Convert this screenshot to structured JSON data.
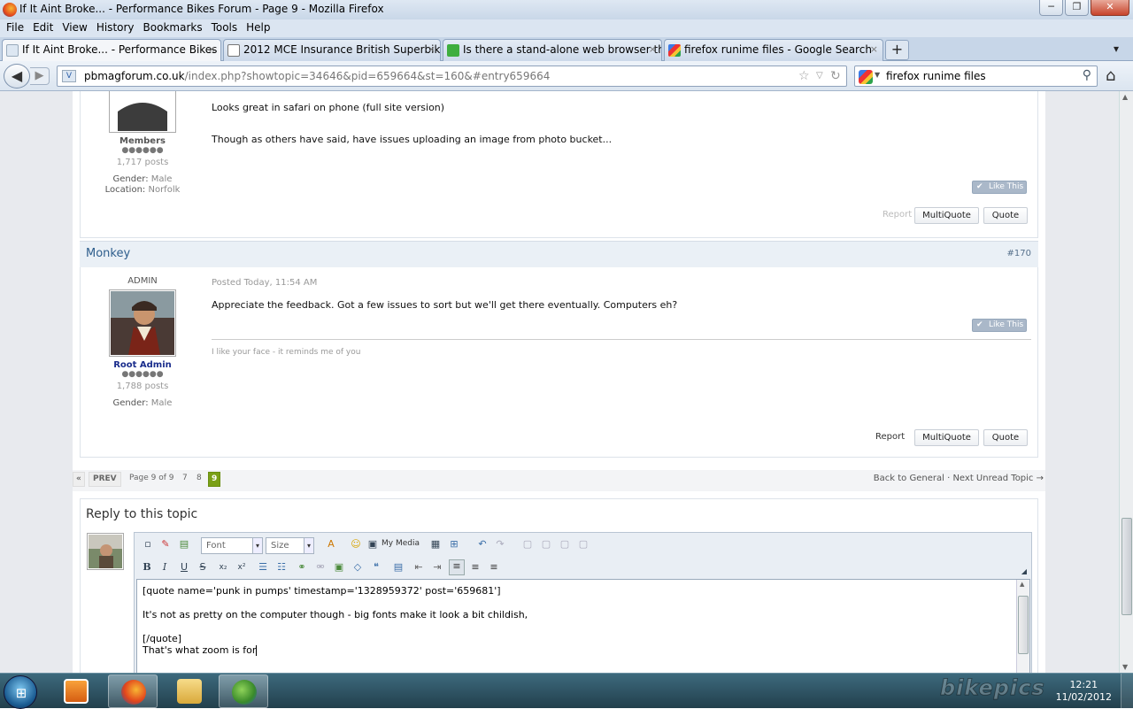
{
  "window": {
    "title": "If It Aint Broke... - Performance Bikes Forum - Page 9 - Mozilla Firefox",
    "minimize": "─",
    "maximize": "❐",
    "close": "✕"
  },
  "menu": [
    "File",
    "Edit",
    "View",
    "History",
    "Bookmarks",
    "Tools",
    "Help"
  ],
  "tabs": [
    {
      "label": "If It Aint Broke... - Performance Bikes ...",
      "close": "×"
    },
    {
      "label": "2012 MCE Insurance British Superbike...",
      "close": "×"
    },
    {
      "label": "Is there a stand-alone web browser th...",
      "close": "×"
    },
    {
      "label": "firefox runime files - Google Search",
      "close": "×"
    }
  ],
  "newtab": "+",
  "nav": {
    "url_domain": "pbmagforum.co.uk",
    "url_path": "/index.php?showtopic=34646&pid=659664&st=160&#entry659664",
    "search_value": "firefox runime files",
    "back_icon": "back-arrow-icon",
    "home_icon": "home-icon"
  },
  "post1": {
    "group": "Members",
    "pips": "●●●●●●",
    "posts": "1,717 posts",
    "gender_label": "Gender:",
    "gender": "Male",
    "location_label": "Location:",
    "location": "Norfolk",
    "lines": [
      "Looks great in safari on phone (full site version)",
      "Though as others have said, have issues uploading an image from photo bucket..."
    ],
    "like": "Like This",
    "report": "Report",
    "multiquote": "MultiQuote",
    "quote": "Quote"
  },
  "post2": {
    "author": "Monkey",
    "number": "#170",
    "role": "ADMIN",
    "posted": "Posted Today, 11:54 AM",
    "group": "Root Admin",
    "pips": "●●●●●●",
    "posts": "1,788 posts",
    "gender_label": "Gender:",
    "gender": "Male",
    "text": "Appreciate the feedback. Got a few issues to sort but we'll get there eventually. Computers eh?",
    "signature": "I like your face - it reminds me of you",
    "like": "Like This",
    "report": "Report",
    "multiquote": "MultiQuote",
    "quote": "Quote"
  },
  "pager": {
    "first": "«",
    "prev": "PREV",
    "info": "Page 9 of 9",
    "pages": [
      "7",
      "8"
    ],
    "current": "9",
    "back": "Back to General",
    "sep": "·",
    "next": "Next Unread Topic →"
  },
  "reply": {
    "heading": "Reply to this topic",
    "font": "Font",
    "size": "Size",
    "mymedia": "My Media",
    "lines": [
      "[quote name='punk in pumps' timestamp='1328959372' post='659681']",
      "It's not as pretty on the computer though - big fonts make it look a bit childish,",
      "[/quote]",
      "That's what zoom is for"
    ]
  },
  "taskbar": {
    "logo": "bikepics",
    "time": "12:21",
    "date": "11/02/2012"
  }
}
